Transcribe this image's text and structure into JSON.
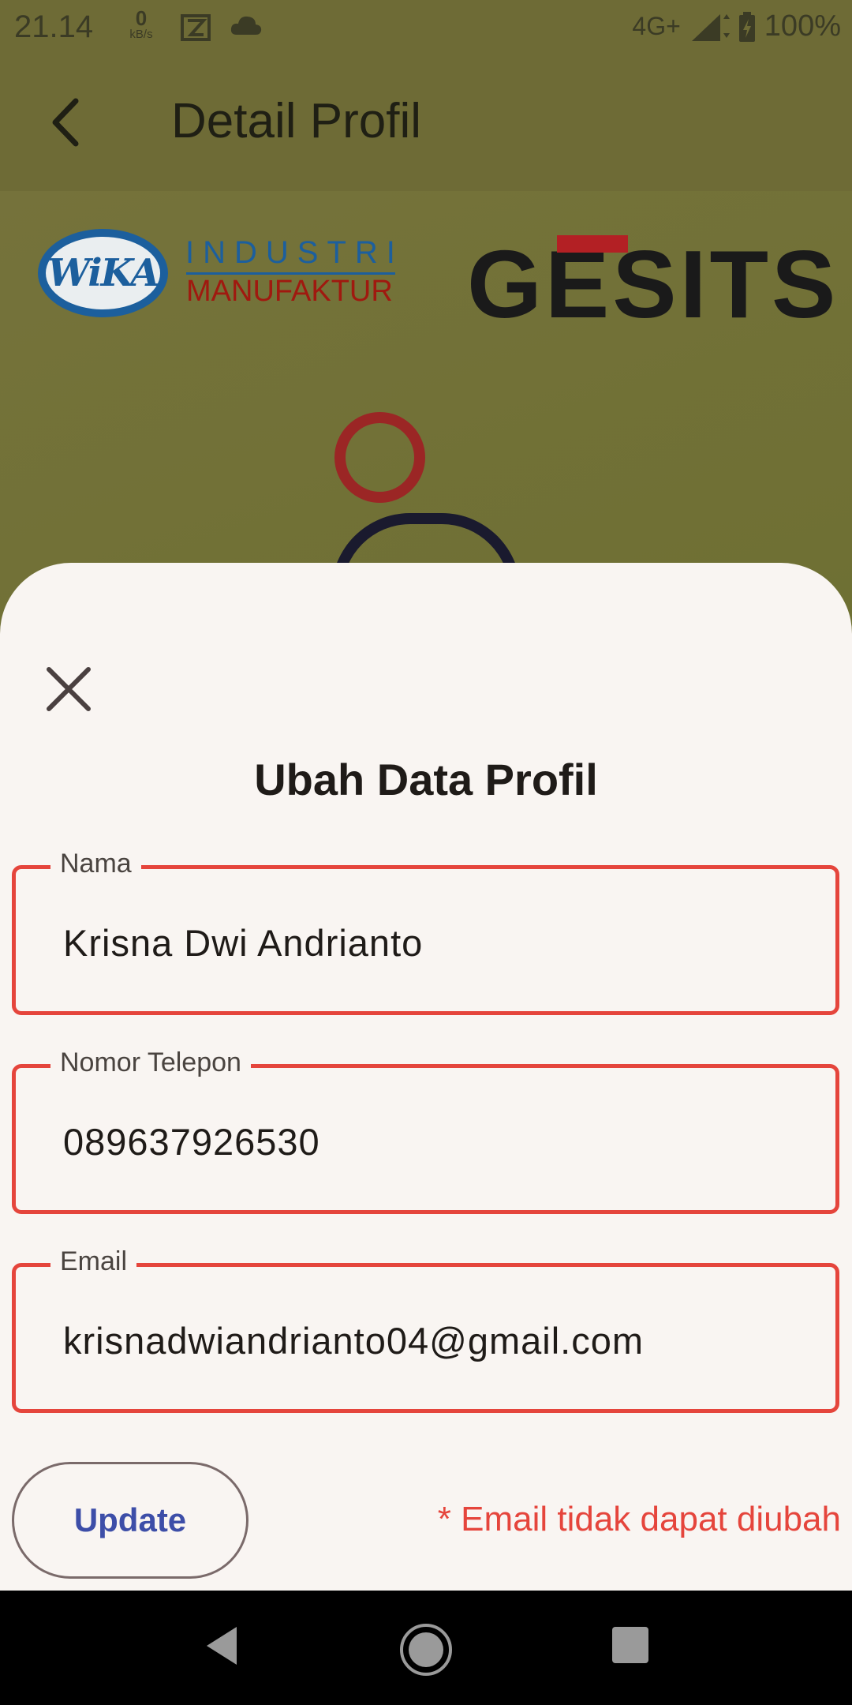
{
  "status_bar": {
    "time": "21.14",
    "speed_value": "0",
    "speed_unit": "kB/s",
    "network": "4G+",
    "battery": "100%"
  },
  "app_bar": {
    "title": "Detail Profil"
  },
  "logos": {
    "wika_mark": "WiKA",
    "wika_line1": "INDUSTRI",
    "wika_line2": "MANUFAKTUR",
    "gesits": "GESITS"
  },
  "sheet": {
    "title": "Ubah Data Profil",
    "fields": [
      {
        "label": "Nama",
        "value": "Krisna Dwi Andrianto"
      },
      {
        "label": "Nomor Telepon",
        "value": "089637926530"
      },
      {
        "label": "Email",
        "value": "krisnadwiandrianto04@gmail.com"
      }
    ],
    "update_label": "Update",
    "note": "* Email tidak dapat diubah"
  },
  "colors": {
    "accent_red": "#e5453c",
    "button_text": "#3d4ea8",
    "sheet_bg": "#f9f5f2",
    "backdrop": "#6e6b36"
  }
}
